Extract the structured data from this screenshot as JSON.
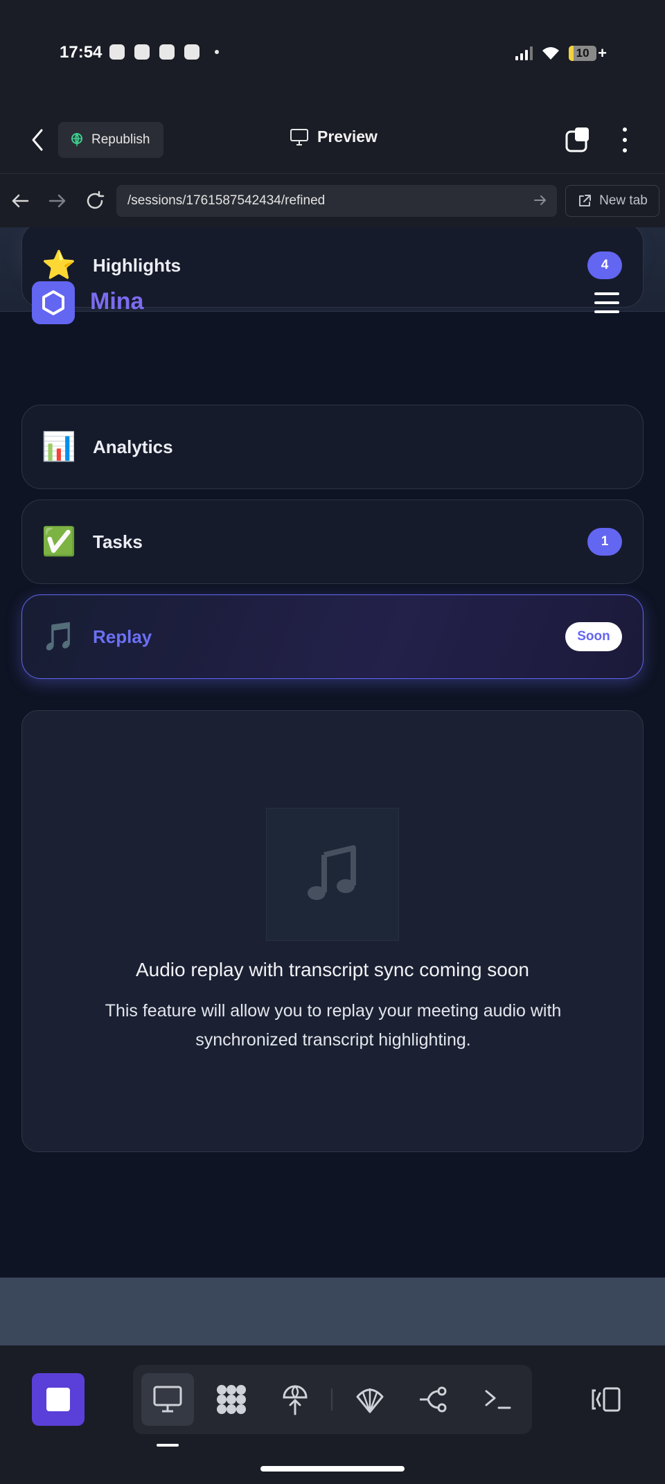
{
  "status_bar": {
    "time": "17:54",
    "battery": "10",
    "battery_level_percent": 10,
    "notification_icons": [
      "snapchat-icon",
      "messenger-icon",
      "gallery-icon",
      "battery-saver-icon",
      "dot-icon"
    ]
  },
  "app_header": {
    "republish_label": "Republish",
    "preview_label": "Preview"
  },
  "url_bar": {
    "url": "/sessions/1761587542434/refined",
    "new_tab_label": "New tab"
  },
  "site": {
    "brand": "Mina"
  },
  "nav_items": [
    {
      "label": "Highlights",
      "emoji": "⭐",
      "badge": "4"
    },
    {
      "label": "Analytics",
      "emoji": "📊"
    },
    {
      "label": "Tasks",
      "emoji": "✅",
      "badge": "1"
    },
    {
      "label": "Replay",
      "emoji": "🎵",
      "tag": "Soon"
    }
  ],
  "replay_panel": {
    "title": "Audio replay with transcript sync coming soon",
    "description": "This feature will allow you to replay your meeting audio with synchronized transcript highlighting."
  },
  "colors": {
    "accent": "#6366f1",
    "brand_text": "#7c6cf0",
    "stop_button": "#5a3fd8",
    "page_background": "#0f1424"
  }
}
